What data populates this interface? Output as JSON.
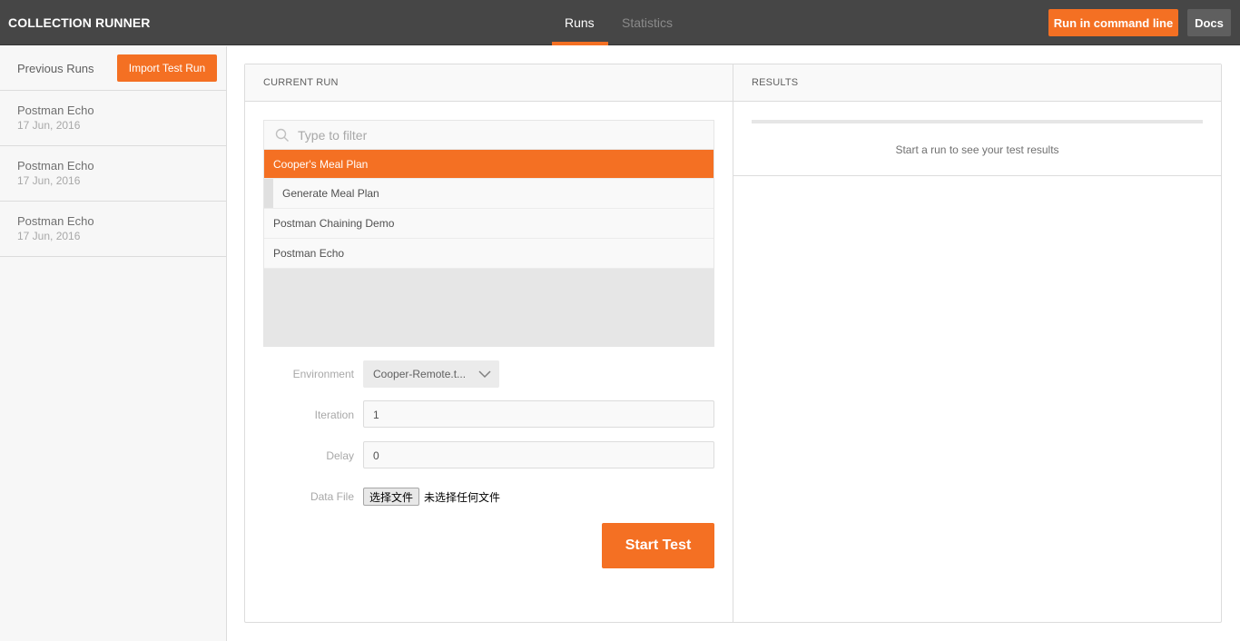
{
  "header": {
    "title": "COLLECTION RUNNER",
    "tabs": [
      {
        "label": "Runs",
        "active": true
      },
      {
        "label": "Statistics",
        "active": false
      }
    ],
    "run_cmd_label": "Run in command line",
    "docs_label": "Docs"
  },
  "sidebar": {
    "title": "Previous Runs",
    "import_label": "Import Test Run",
    "runs": [
      {
        "name": "Postman Echo",
        "date": "17 Jun, 2016"
      },
      {
        "name": "Postman Echo",
        "date": "17 Jun, 2016"
      },
      {
        "name": "Postman Echo",
        "date": "17 Jun, 2016"
      }
    ]
  },
  "current_run": {
    "heading": "CURRENT RUN",
    "filter_placeholder": "Type to filter",
    "collections": [
      {
        "label": "Cooper's Meal Plan",
        "selected": true
      },
      {
        "label": "Generate Meal Plan",
        "folder": true
      },
      {
        "label": "Postman Chaining Demo"
      },
      {
        "label": "Postman Echo"
      }
    ],
    "environment_label": "Environment",
    "environment_value": "Cooper-Remote.t...",
    "iteration_label": "Iteration",
    "iteration_value": "1",
    "delay_label": "Delay",
    "delay_value": "0",
    "datafile_label": "Data File",
    "choose_file_label": "选择文件",
    "no_file_label": "未选择任何文件",
    "start_label": "Start Test"
  },
  "results": {
    "heading": "RESULTS",
    "empty_message": "Start a run to see your test results"
  },
  "colors": {
    "accent": "#f47023",
    "header_bg": "#464646"
  }
}
